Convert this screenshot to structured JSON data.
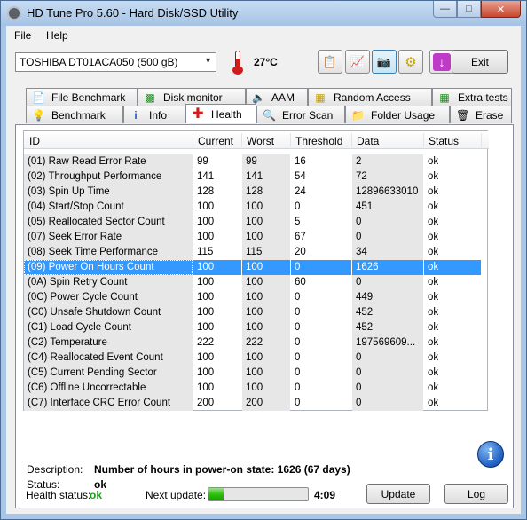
{
  "window": {
    "title": "HD Tune Pro 5.60 - Hard Disk/SSD Utility"
  },
  "menu": [
    {
      "label": "File"
    },
    {
      "label": "Help"
    }
  ],
  "toolbar": {
    "drive": "TOSHIBA DT01ACA050 (500 gB)",
    "temperature": "27°C",
    "exit_label": "Exit"
  },
  "tabs_top": [
    {
      "label": "File Benchmark"
    },
    {
      "label": "Disk monitor"
    },
    {
      "label": "AAM"
    },
    {
      "label": "Random Access"
    },
    {
      "label": "Extra tests"
    }
  ],
  "tabs_bottom": [
    {
      "label": "Benchmark"
    },
    {
      "label": "Info"
    },
    {
      "label": "Health"
    },
    {
      "label": "Error Scan"
    },
    {
      "label": "Folder Usage"
    },
    {
      "label": "Erase"
    }
  ],
  "table": {
    "columns": [
      "ID",
      "Current",
      "Worst",
      "Threshold",
      "Data",
      "Status"
    ],
    "rows": [
      {
        "id": "(01) Raw Read Error Rate",
        "current": "99",
        "worst": "99",
        "threshold": "16",
        "data": "2",
        "status": "ok"
      },
      {
        "id": "(02) Throughput Performance",
        "current": "141",
        "worst": "141",
        "threshold": "54",
        "data": "72",
        "status": "ok"
      },
      {
        "id": "(03) Spin Up Time",
        "current": "128",
        "worst": "128",
        "threshold": "24",
        "data": "12896633010",
        "status": "ok"
      },
      {
        "id": "(04) Start/Stop Count",
        "current": "100",
        "worst": "100",
        "threshold": "0",
        "data": "451",
        "status": "ok"
      },
      {
        "id": "(05) Reallocated Sector Count",
        "current": "100",
        "worst": "100",
        "threshold": "5",
        "data": "0",
        "status": "ok"
      },
      {
        "id": "(07) Seek Error Rate",
        "current": "100",
        "worst": "100",
        "threshold": "67",
        "data": "0",
        "status": "ok"
      },
      {
        "id": "(08) Seek Time Performance",
        "current": "115",
        "worst": "115",
        "threshold": "20",
        "data": "34",
        "status": "ok"
      },
      {
        "id": "(09) Power On Hours Count",
        "current": "100",
        "worst": "100",
        "threshold": "0",
        "data": "1626",
        "status": "ok"
      },
      {
        "id": "(0A) Spin Retry Count",
        "current": "100",
        "worst": "100",
        "threshold": "60",
        "data": "0",
        "status": "ok"
      },
      {
        "id": "(0C) Power Cycle Count",
        "current": "100",
        "worst": "100",
        "threshold": "0",
        "data": "449",
        "status": "ok"
      },
      {
        "id": "(C0) Unsafe Shutdown Count",
        "current": "100",
        "worst": "100",
        "threshold": "0",
        "data": "452",
        "status": "ok"
      },
      {
        "id": "(C1) Load Cycle Count",
        "current": "100",
        "worst": "100",
        "threshold": "0",
        "data": "452",
        "status": "ok"
      },
      {
        "id": "(C2) Temperature",
        "current": "222",
        "worst": "222",
        "threshold": "0",
        "data": "197569609...",
        "status": "ok"
      },
      {
        "id": "(C4) Reallocated Event Count",
        "current": "100",
        "worst": "100",
        "threshold": "0",
        "data": "0",
        "status": "ok"
      },
      {
        "id": "(C5) Current Pending Sector",
        "current": "100",
        "worst": "100",
        "threshold": "0",
        "data": "0",
        "status": "ok"
      },
      {
        "id": "(C6) Offline Uncorrectable",
        "current": "100",
        "worst": "100",
        "threshold": "0",
        "data": "0",
        "status": "ok"
      },
      {
        "id": "(C7) Interface CRC Error Count",
        "current": "200",
        "worst": "200",
        "threshold": "0",
        "data": "0",
        "status": "ok"
      }
    ]
  },
  "details": {
    "description_label": "Description:",
    "description_value": "Number of hours in power-on state: 1626 (67 days)",
    "status_label": "Status:",
    "status_value": "ok"
  },
  "footer": {
    "health_label": "Health status:",
    "health_value": "ok",
    "next_update_label": "Next update:",
    "progress_fraction": 0.15,
    "countdown": "4:09",
    "update_label": "Update",
    "log_label": "Log"
  },
  "colors": {
    "selection": "#3399ff",
    "health_ok": "#1a9c1a"
  }
}
